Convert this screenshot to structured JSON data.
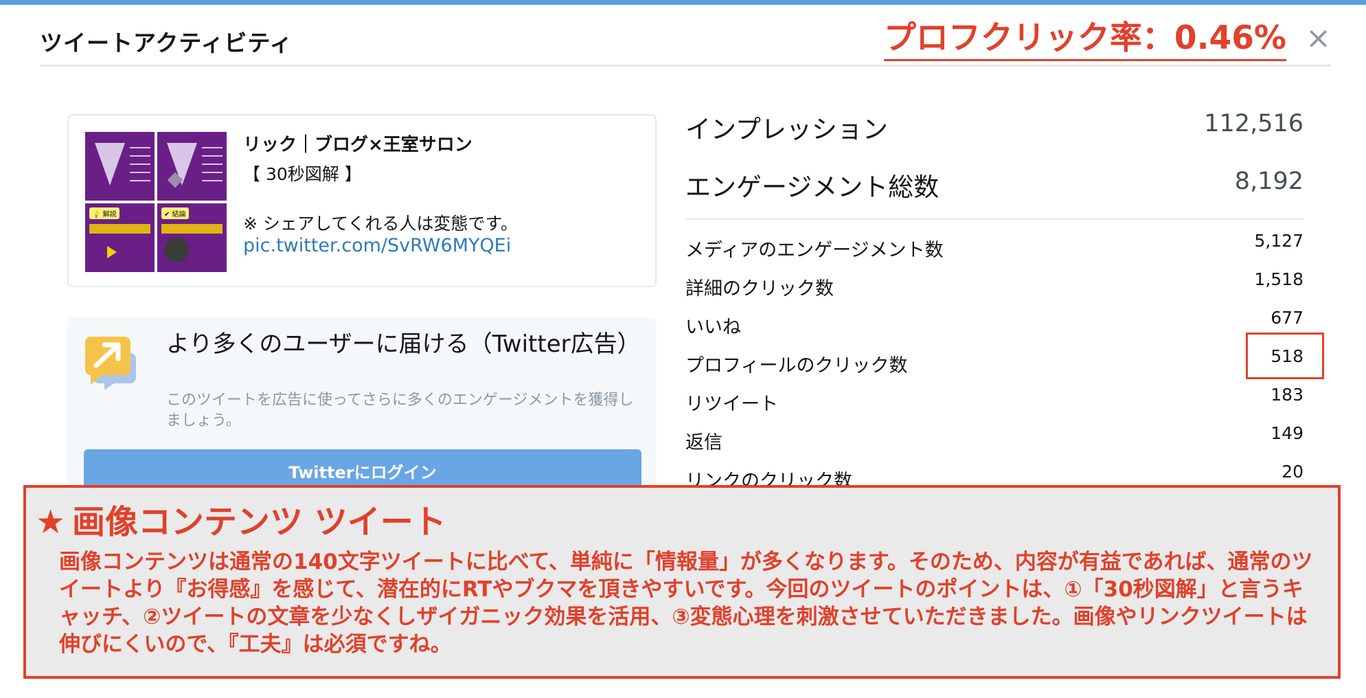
{
  "header": {
    "title": "ツイートアクティビティ",
    "annotation": "プロフクリック率：0.46%",
    "close_glyph": "×"
  },
  "tweet": {
    "author": "リック｜ブログ×王室サロン",
    "line2": "【 30秒図解 】",
    "line3": "※ シェアしてくれる人は変態です。",
    "link": "pic.twitter.com/SvRW6MYQEi",
    "thumbnails": [
      {
        "caption": "",
        "badge": ""
      },
      {
        "caption": "",
        "badge": ""
      },
      {
        "caption": "解説",
        "badge": "💡"
      },
      {
        "caption": "結論",
        "badge": "✔"
      }
    ]
  },
  "promote": {
    "icon": "promote-arrow-icon",
    "title": "より多くのユーザーに届ける（Twitter広告）",
    "description": "このツイートを広告に使ってさらに多くのエンゲージメントを獲得しましょう。",
    "button_label": "Twitterにログイン"
  },
  "metrics": {
    "impressions": {
      "label": "インプレッション",
      "value": "112,516"
    },
    "engagements": {
      "label": "エンゲージメント総数",
      "value": "8,192"
    },
    "rows": [
      {
        "label": "メディアのエンゲージメント数",
        "value": "5,127"
      },
      {
        "label": "詳細のクリック数",
        "value": "1,518"
      },
      {
        "label": "いいね",
        "value": "677"
      },
      {
        "label": "プロフィールのクリック数",
        "value": "518"
      },
      {
        "label": "リツイート",
        "value": "183"
      },
      {
        "label": "返信",
        "value": "149"
      },
      {
        "label": "リンクのクリック数",
        "value": "20"
      }
    ]
  },
  "note": {
    "star": "★",
    "title": "画像コンテンツ ツイート",
    "body": "画像コンテンツは通常の140文字ツイートに比べて、単純に「情報量」が多くなります。そのため、内容が有益であれば、通常のツイートより『お得感』を感じて、潜在的にRTやブクマを頂きやすいです。今回のツイートのポイントは、①「30秒図解」と言うキャッチ、②ツイートの文章を少なくしザイガニック効果を活用、③変態心理を刺激させていただきました。画像やリンクツイートは伸びにくいので、『工夫』は必須ですね。"
  },
  "colors": {
    "accent_red": "#e0412b",
    "link_blue": "#2b7bb9",
    "button_blue": "#6aa6e4",
    "thumb_purple": "#6a1f86"
  }
}
